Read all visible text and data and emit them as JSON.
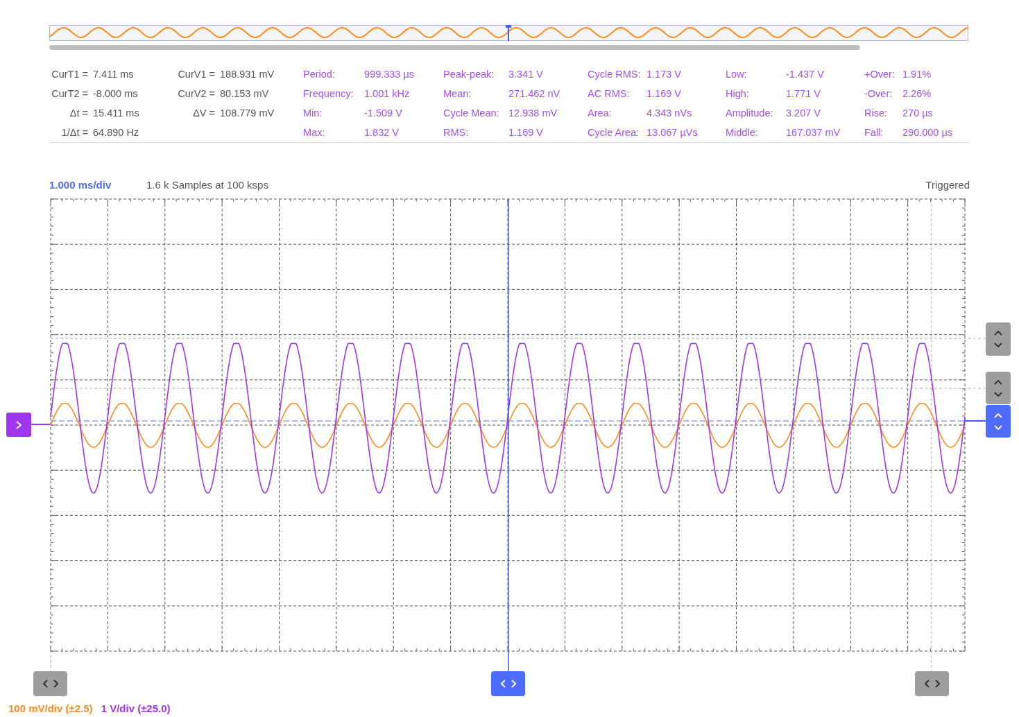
{
  "cursor_readouts": [
    [
      {
        "label": "CurT1 =",
        "value": "7.411 ms"
      },
      {
        "label": "CurT2 =",
        "value": "-8.000 ms"
      },
      {
        "label": "Δt =",
        "value": "15.411 ms"
      },
      {
        "label": "1/Δt =",
        "value": "64.890 Hz"
      }
    ],
    [
      {
        "label": "CurV1 =",
        "value": "188.931 mV"
      },
      {
        "label": "CurV2 =",
        "value": "80.153 mV"
      },
      {
        "label": "ΔV =",
        "value": "108.779 mV"
      }
    ]
  ],
  "measurements": [
    [
      {
        "label": "Period:",
        "value": "999.333 µs"
      },
      {
        "label": "Frequency:",
        "value": "1.001 kHz"
      },
      {
        "label": "Min:",
        "value": "-1.509 V"
      },
      {
        "label": "Max:",
        "value": "1.832 V"
      }
    ],
    [
      {
        "label": "Peak-peak:",
        "value": "3.341 V"
      },
      {
        "label": "Mean:",
        "value": "271.462 nV"
      },
      {
        "label": "Cycle Mean:",
        "value": "12.938 mV"
      },
      {
        "label": "RMS:",
        "value": "1.169 V"
      }
    ],
    [
      {
        "label": "Cycle RMS:",
        "value": "1.173 V"
      },
      {
        "label": "AC RMS:",
        "value": "1.169 V"
      },
      {
        "label": "Area:",
        "value": "4.343 nVs"
      },
      {
        "label": "Cycle Area:",
        "value": "13.067 µVs"
      }
    ],
    [
      {
        "label": "Low:",
        "value": "-1.437 V"
      },
      {
        "label": "High:",
        "value": "1.771 V"
      },
      {
        "label": "Amplitude:",
        "value": "3.207 V"
      },
      {
        "label": "Middle:",
        "value": "167.037 mV"
      }
    ],
    [
      {
        "label": "+Over:",
        "value": "1.91%"
      },
      {
        "label": "-Over:",
        "value": "2.26%"
      },
      {
        "label": "Rise:",
        "value": "270 µs"
      },
      {
        "label": "Fall:",
        "value": "290.000 µs"
      }
    ]
  ],
  "timebase": "1.000 ms/div",
  "samples": "1.6 k Samples at 100 ksps",
  "trigger_status": "Triggered",
  "channels": [
    {
      "scale": "100 mV/div (±2.5)",
      "color": "#ff8a1f"
    },
    {
      "scale": "1 V/div (±25.0)",
      "color": "#a035f0"
    }
  ],
  "offset_handles": [
    {
      "selected": false
    },
    {
      "selected": false
    },
    {
      "selected": true
    }
  ],
  "cursor_handles": [
    {
      "selected": false
    },
    {
      "selected": true
    },
    {
      "selected": false
    }
  ]
}
